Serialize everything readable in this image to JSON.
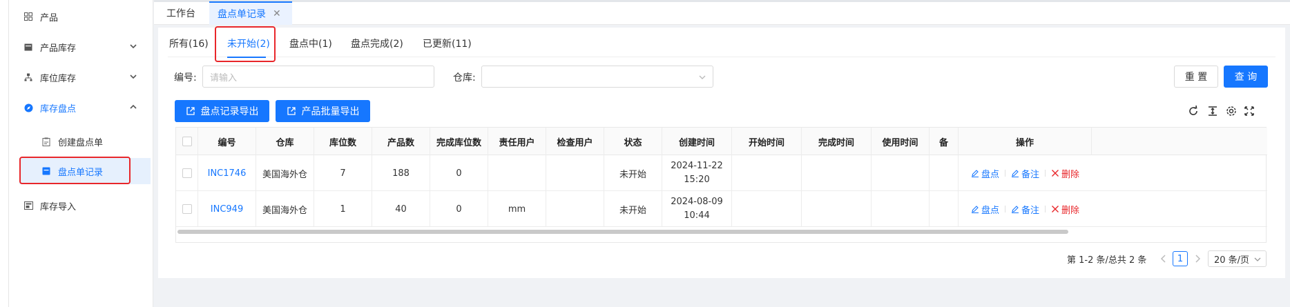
{
  "sidebar": {
    "items": [
      {
        "label": "产品",
        "icon": "grid-icon"
      },
      {
        "label": "产品库存",
        "icon": "inventory-icon"
      },
      {
        "label": "库位库存",
        "icon": "location-icon"
      },
      {
        "label": "库存盘点",
        "icon": "compass-icon"
      },
      {
        "label": "库存导入",
        "icon": "import-icon"
      }
    ],
    "subitems": [
      {
        "label": "创建盘点单",
        "icon": "clipboard-icon"
      },
      {
        "label": "盘点单记录",
        "icon": "records-icon"
      }
    ]
  },
  "top_tabs": [
    {
      "label": "工作台"
    },
    {
      "label": "盘点单记录",
      "close": "✕"
    }
  ],
  "status_tabs": [
    {
      "label": "所有(16)"
    },
    {
      "label": "未开始(2)"
    },
    {
      "label": "盘点中(1)"
    },
    {
      "label": "盘点完成(2)"
    },
    {
      "label": "已更新(11)"
    }
  ],
  "filters": {
    "code_label": "编号:",
    "code_placeholder": "请输入",
    "warehouse_label": "仓库:",
    "warehouse_value": "",
    "reset_label": "重 置",
    "search_label": "查 询"
  },
  "actions": {
    "export_records": "盘点记录导出",
    "export_products": "产品批量导出"
  },
  "table": {
    "headers": [
      "编号",
      "仓库",
      "库位数",
      "产品数",
      "完成库位数",
      "责任用户",
      "检查用户",
      "状态",
      "创建时间",
      "开始时间",
      "完成时间",
      "使用时间",
      "备",
      "操作"
    ],
    "rows": [
      {
        "code": "INC1746",
        "warehouse": "美国海外仓",
        "locations": "7",
        "products": "188",
        "done": "0",
        "owner": "",
        "checker": "",
        "status": "未开始",
        "created_date": "2024-11-22",
        "created_time": "15:20",
        "start": "",
        "finish": "",
        "used": "",
        "note": ""
      },
      {
        "code": "INC949",
        "warehouse": "美国海外仓",
        "locations": "1",
        "products": "40",
        "done": "0",
        "owner": "mm",
        "checker": "",
        "status": "未开始",
        "created_date": "2024-08-09",
        "created_time": "10:44",
        "start": "",
        "finish": "",
        "used": "",
        "note": ""
      }
    ],
    "ops": {
      "count": "盘点",
      "remark": "备注",
      "delete": "删除"
    }
  },
  "pagination": {
    "summary": "第 1-2 条/总共 2 条",
    "current": "1",
    "page_size": "20 条/页"
  },
  "colors": {
    "primary": "#1677ff",
    "danger": "#e8262a"
  }
}
